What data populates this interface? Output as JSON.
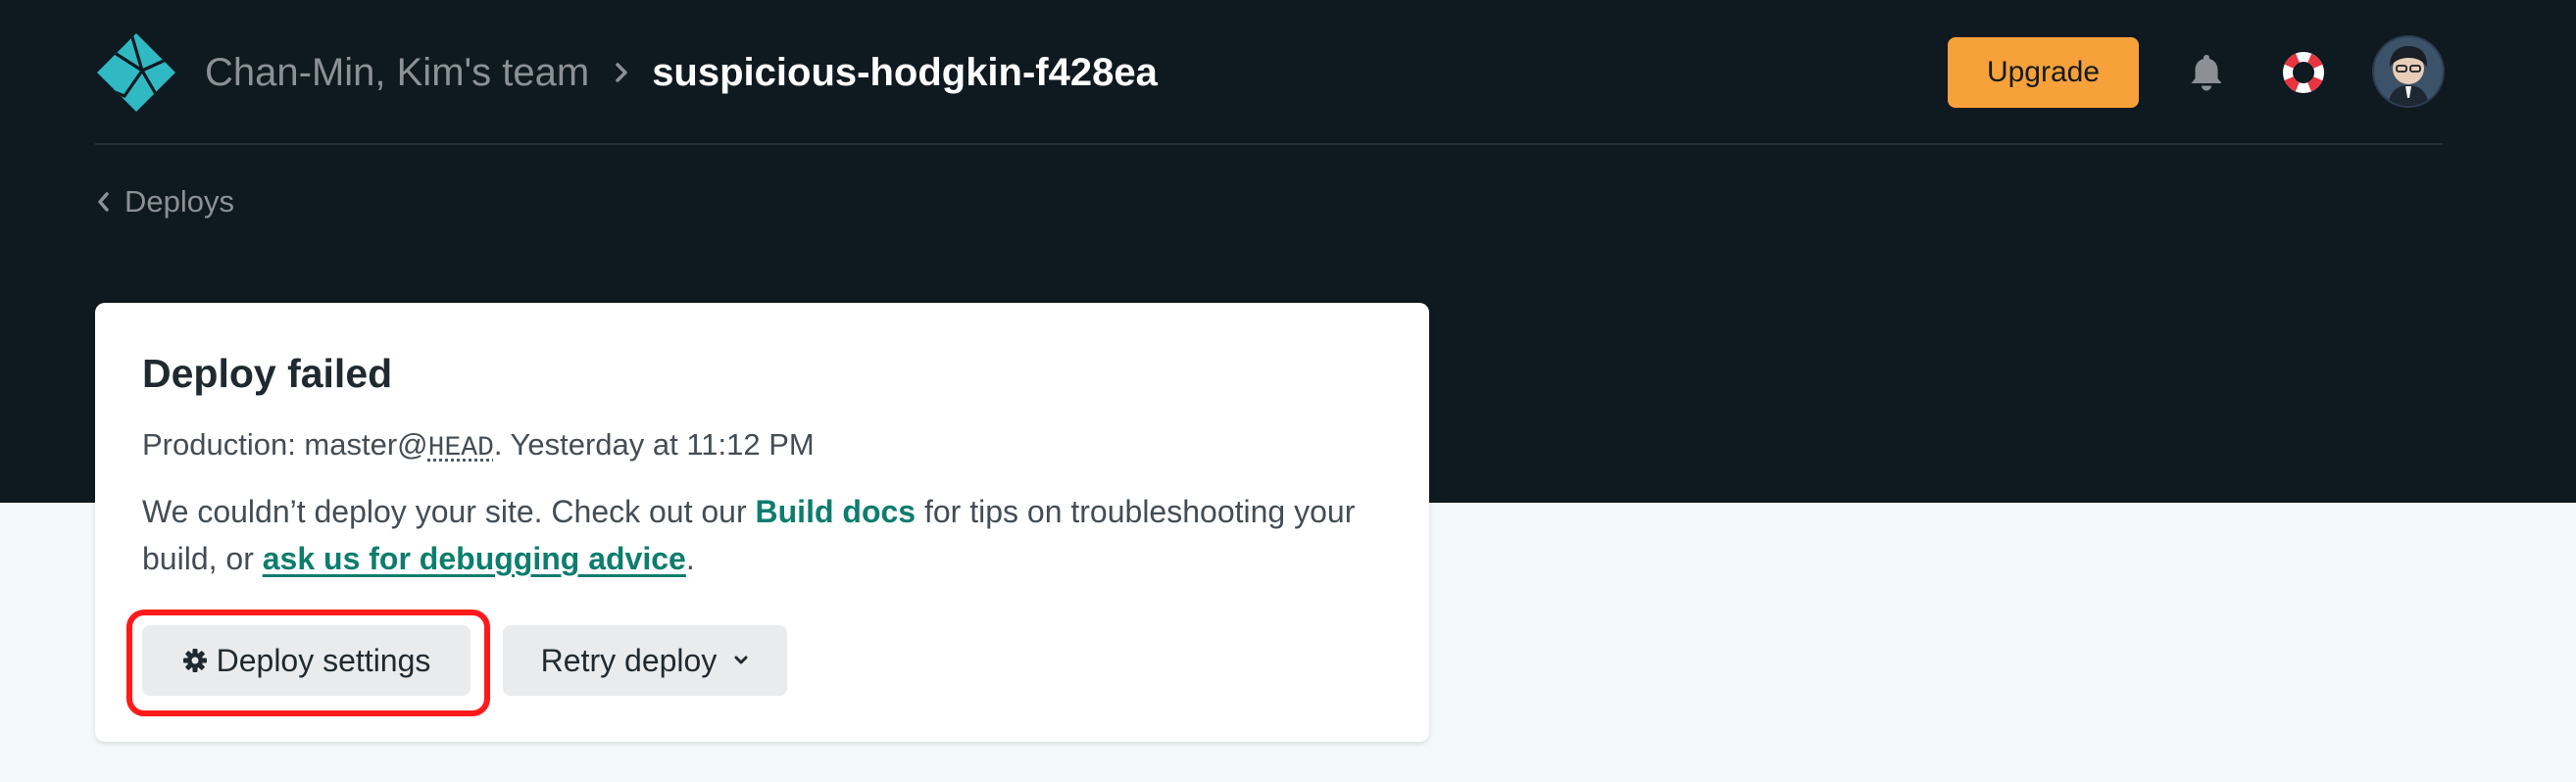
{
  "header": {
    "team_name": "Chan-Min, Kim's team",
    "site_name": "suspicious-hodgkin-f428ea",
    "upgrade_label": "Upgrade",
    "icons": [
      "netlify-logo-icon",
      "chevron-right-icon",
      "bell-icon",
      "lifebuoy-icon",
      "avatar"
    ]
  },
  "nav": {
    "back_label": "Deploys"
  },
  "card": {
    "title": "Deploy failed",
    "meta_prefix": "Production: master@",
    "meta_ref": "HEAD",
    "meta_suffix": ". Yesterday at 11:12 PM",
    "msg_part1": "We couldn’t deploy your site. Check out our ",
    "build_docs_link": "Build docs",
    "msg_part2": " for tips on troubleshooting your build, or ",
    "debug_link": "ask us for debugging advice",
    "msg_part3": ".",
    "settings_label": "Deploy settings",
    "retry_label": "Retry deploy"
  },
  "colors": {
    "header_bg": "#0e1920",
    "page_bg": "#f4f9f9",
    "accent": "#f7a13a",
    "link": "#0d7d6e",
    "highlight": "#ff1a1a"
  }
}
